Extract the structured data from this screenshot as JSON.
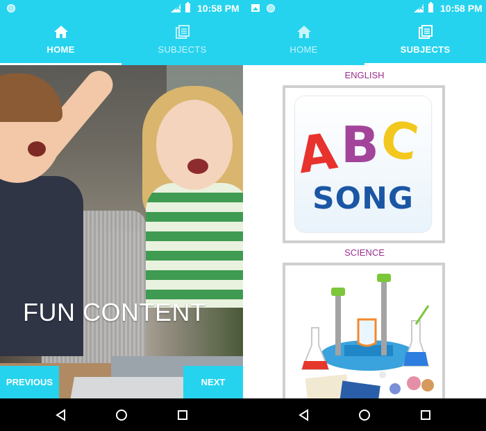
{
  "status": {
    "time": "10:58 PM"
  },
  "tabs": {
    "home_label": "HOME",
    "subjects_label": "SUBJECTS"
  },
  "slider": {
    "caption": "FUN CONTENT",
    "previous_label": "PREVIOUS",
    "next_label": "NEXT"
  },
  "subjects": [
    {
      "name": "ENGLISH"
    },
    {
      "name": "SCIENCE"
    }
  ],
  "abc_card": {
    "letters": [
      "A",
      "B",
      "C"
    ],
    "word": "SONG"
  },
  "colors": {
    "primary": "#26d3ee",
    "subject_label": "#9b2d8d"
  }
}
